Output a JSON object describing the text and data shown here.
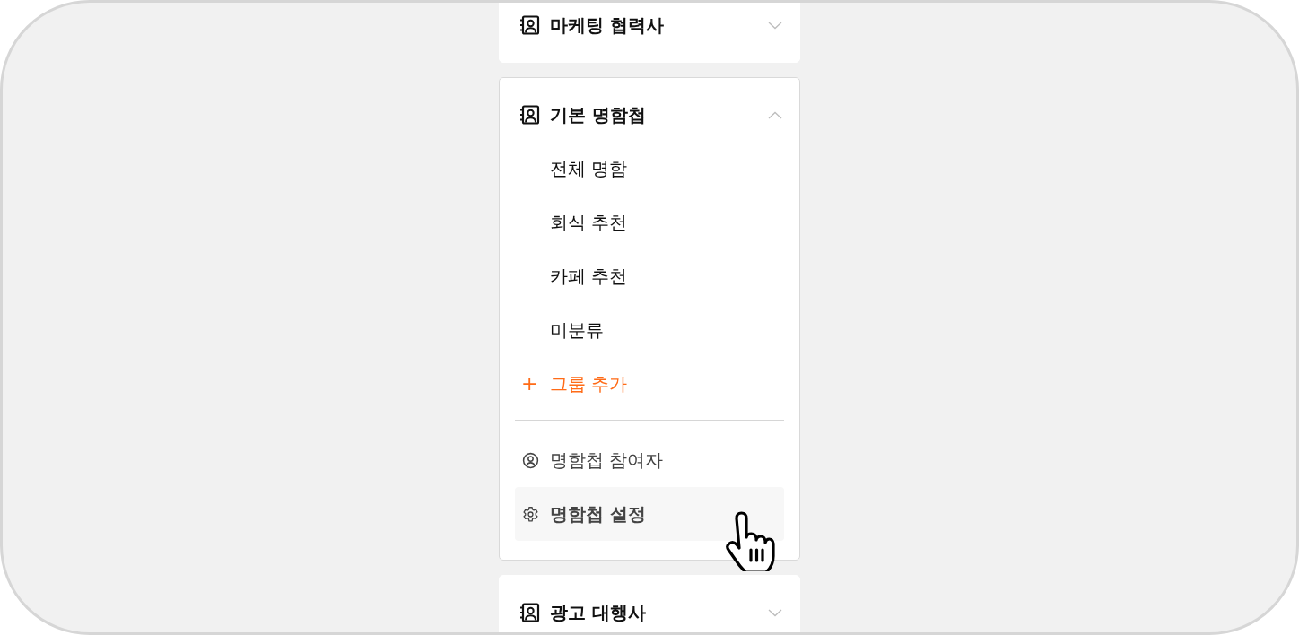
{
  "cards": [
    {
      "title": "마케팅 협력사",
      "expanded": false
    },
    {
      "title": "기본 명함첩",
      "expanded": true,
      "groups": [
        "전체 명함",
        "회식 추천",
        "카페 추천",
        "미분류"
      ],
      "add_group": {
        "symbol": "+",
        "label": "그룹 추가"
      },
      "footer_items": [
        {
          "kind": "participants",
          "label": "명함첩 참여자",
          "hovered": false
        },
        {
          "kind": "settings",
          "label": "명함첩 설정",
          "hovered": true
        }
      ]
    },
    {
      "title": "광고 대행사",
      "expanded": false
    }
  ]
}
